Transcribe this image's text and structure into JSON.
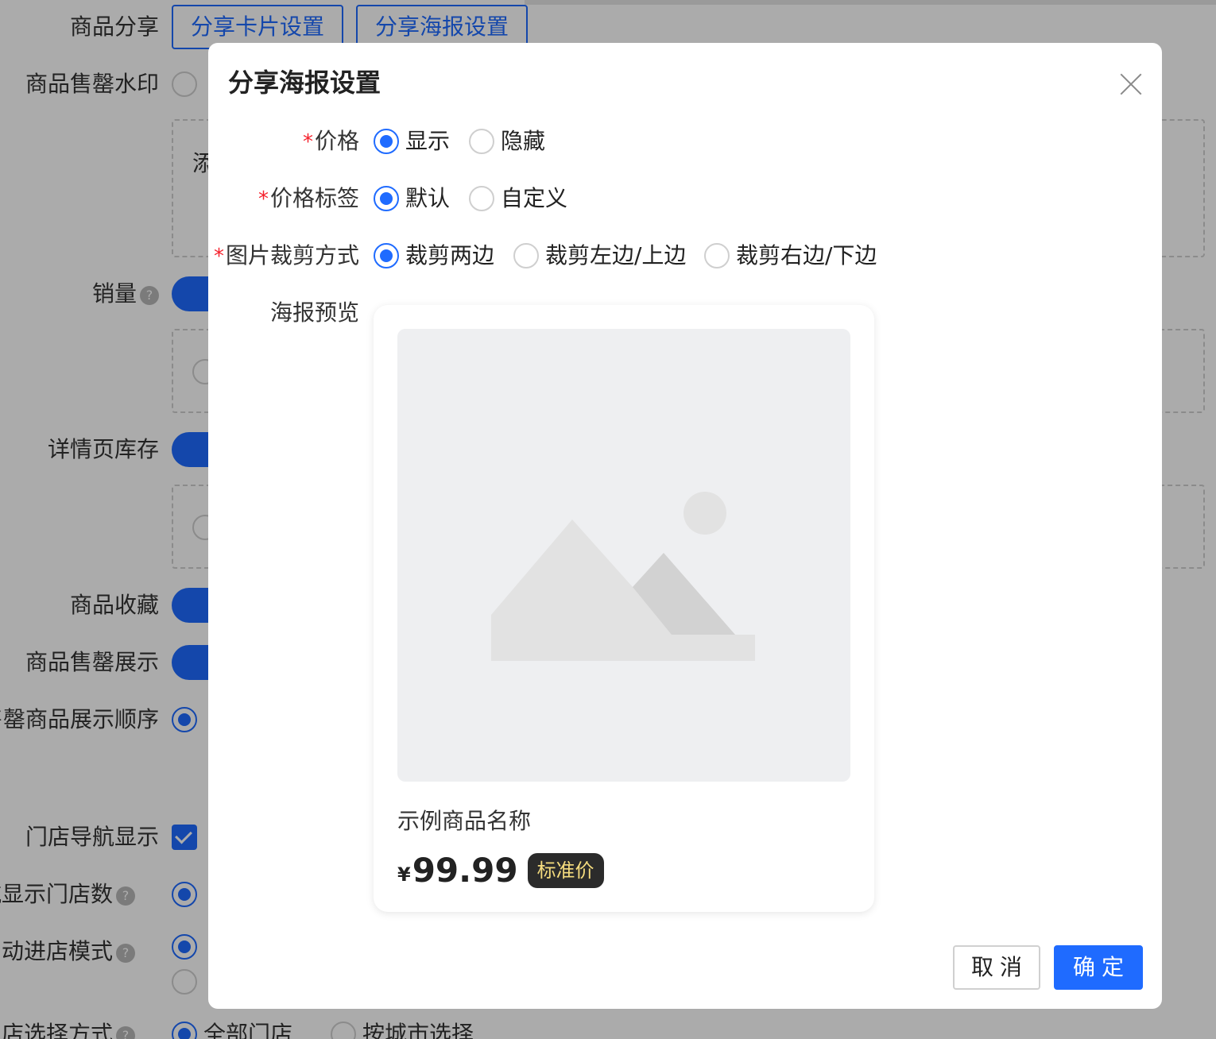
{
  "background": {
    "share_label": "商品分享",
    "share_card_button": "分享卡片设置",
    "share_poster_button": "分享海报设置",
    "watermark_label": "商品售罄水印",
    "dashed_partial_text": "添",
    "sales_label": "销量",
    "detail_stock_label": "详情页库存",
    "favorite_label": "商品收藏",
    "soldout_display_label": "商品售罄展示",
    "soldout_order_label": "售罄商品展示顺序",
    "store_nav_label": "门店导航显示",
    "nav_store_count_label": "导航显示门店数",
    "auto_enter_label": "自动进店模式",
    "store_select_label": "门店选择方式",
    "store_select_options": [
      "全部门店",
      "按城市选择"
    ]
  },
  "dialog": {
    "title": "分享海报设置",
    "fields": {
      "price": {
        "label": "价格",
        "options": [
          "显示",
          "隐藏"
        ],
        "selected": "显示"
      },
      "price_tag": {
        "label": "价格标签",
        "options": [
          "默认",
          "自定义"
        ],
        "selected": "默认"
      },
      "crop": {
        "label": "图片裁剪方式",
        "options": [
          "裁剪两边",
          "裁剪左边/上边",
          "裁剪右边/下边"
        ],
        "selected": "裁剪两边"
      },
      "preview_label": "海报预览"
    },
    "preview": {
      "product_name": "示例商品名称",
      "currency": "¥",
      "price": "99.99",
      "price_tag": "标准价"
    },
    "buttons": {
      "cancel": "取消",
      "confirm": "确定"
    }
  },
  "colors": {
    "primary": "#1f6bff",
    "required": "#f5222d",
    "tag_bg": "#2b2b2b",
    "tag_text": "#f5dc7e"
  }
}
